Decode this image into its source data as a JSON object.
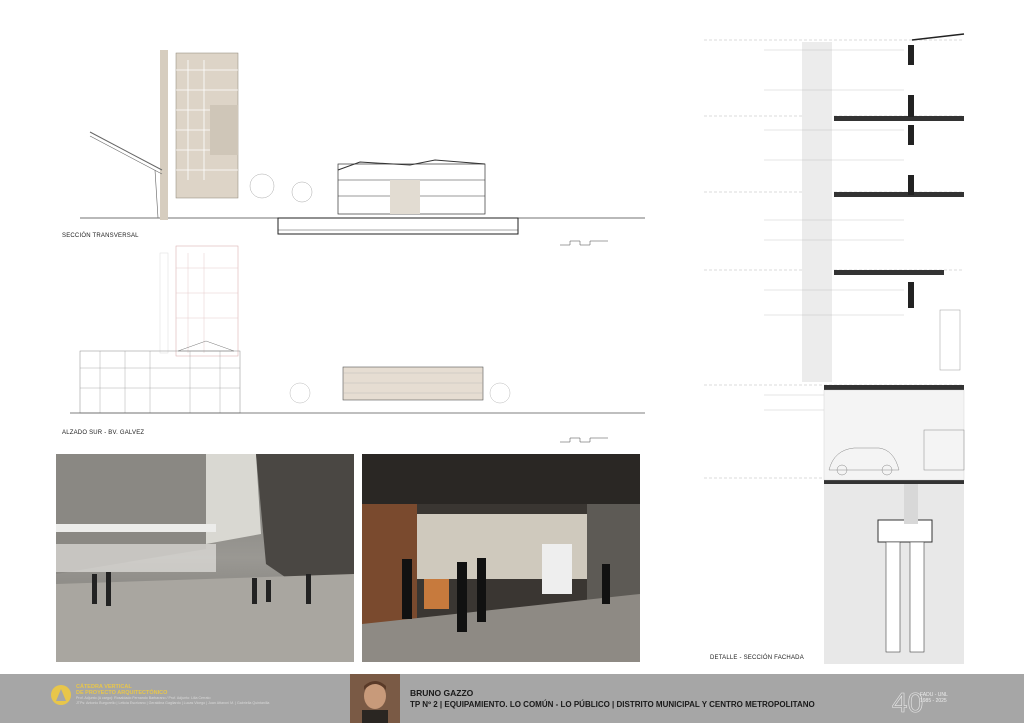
{
  "drawings": {
    "section_label": "SECCIÓN TRANSVERSAL",
    "elevation_label": "ALZADO SUR - BV. GALVEZ",
    "detail_label": "DETALLE - SECCIÓN FACHADA"
  },
  "footer": {
    "chair_line1": "CÁTEDRA VERTICAL",
    "chair_line2": "DE PROYECTO ARQUITECTÓNICO",
    "chair_faculty_line1": "Prof. Adjunto (A cargo): Rosaldado Fernando Barbarano / Prof. Adjunto: Lilia Cerrato",
    "chair_faculty_line2": "JTPs: Antonio Burgorello | Leticia Escrivano | Geraldina Gagliardo | Lucas Vicego | Juan Attaroni M. | Gabriella Quintanilla",
    "student_name": "BRUNO GAZZO",
    "project_title": "TP Nº 2 | EQUIPAMIENTO. LO COMÚN - LO PÚBLICO | DISTRITO MUNICIPAL Y CENTRO METROPOLITANO",
    "anniversary_line1": "FADU - UNL",
    "anniversary_line2": "1985 - 2025",
    "anniversary_number": "40"
  },
  "colors": {
    "footer_bg": "#a6a6a6",
    "chair_yellow": "#e8c64a",
    "tower_beige": "#d8cfc2",
    "line": "#555555"
  }
}
